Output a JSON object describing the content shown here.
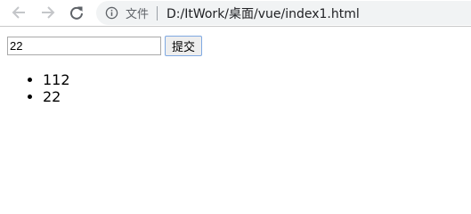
{
  "browser": {
    "back_icon": "arrow-left-icon",
    "forward_icon": "arrow-right-icon",
    "reload_icon": "reload-icon",
    "site_info_icon": "info-icon",
    "scheme_label": "文件",
    "url": "D:/ItWork/桌面/vue/index1.html"
  },
  "form": {
    "input_value": "22",
    "submit_label": "提交"
  },
  "list": {
    "items": [
      "112",
      "22"
    ]
  },
  "colors": {
    "submit_border": "#7fa9e2",
    "omnibox_bg": "#f1f3f4"
  }
}
